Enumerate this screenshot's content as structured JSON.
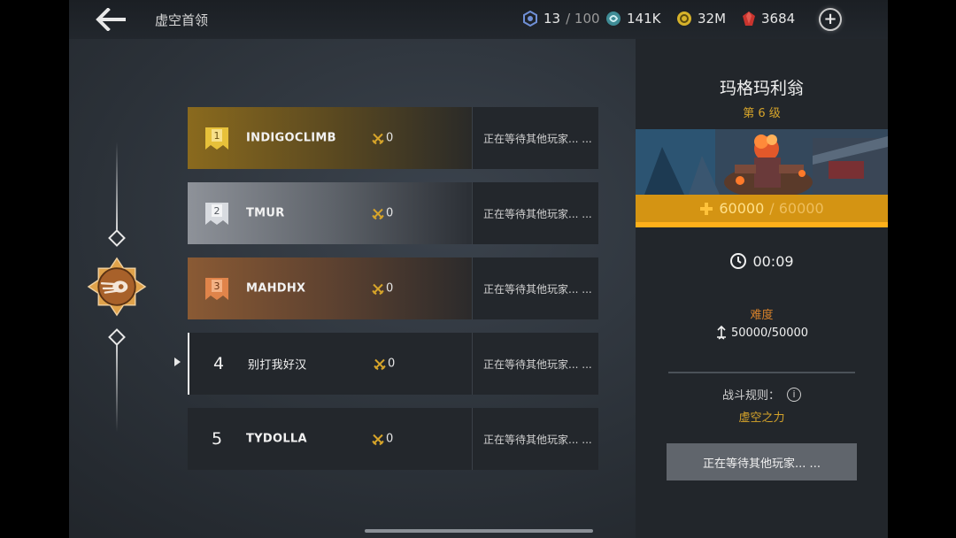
{
  "header": {
    "title": "虚空首领",
    "resources": [
      {
        "icon": "void-token-icon",
        "value": "13",
        "max": "/ 100"
      },
      {
        "icon": "energy-orb-icon",
        "value": "141K"
      },
      {
        "icon": "coin-icon",
        "value": "32M"
      },
      {
        "icon": "ruby-gem-icon",
        "value": "3684"
      }
    ]
  },
  "leaderboard": {
    "rows": [
      {
        "rank": "1",
        "name": "INDIGOCLIMB",
        "score": "0",
        "status": "正在等待其他玩家... ..."
      },
      {
        "rank": "2",
        "name": "TMUR",
        "score": "0",
        "status": "正在等待其他玩家... ..."
      },
      {
        "rank": "3",
        "name": "MAHDHX",
        "score": "0",
        "status": "正在等待其他玩家... ..."
      },
      {
        "rank": "4",
        "name": "别打我好汉",
        "score": "0",
        "status": "正在等待其他玩家... ..."
      },
      {
        "rank": "5",
        "name": "TYDOLLA",
        "score": "0",
        "status": "正在等待其他玩家... ..."
      }
    ]
  },
  "boss": {
    "name": "玛格玛利翁",
    "level": "第 6 级",
    "hp_current": "60000",
    "hp_max": "/ 60000",
    "hp_fraction": 1.0,
    "timer": "00:09",
    "difficulty_label": "难度",
    "difficulty_value": "50000/50000",
    "rules_label": "战斗规则：",
    "rules_value": "虚空之力",
    "wait_button": "正在等待其他玩家... ..."
  },
  "colors": {
    "gold": "#d6a42a",
    "hp_bar": "#d49413",
    "difficulty": "#d9822a"
  }
}
